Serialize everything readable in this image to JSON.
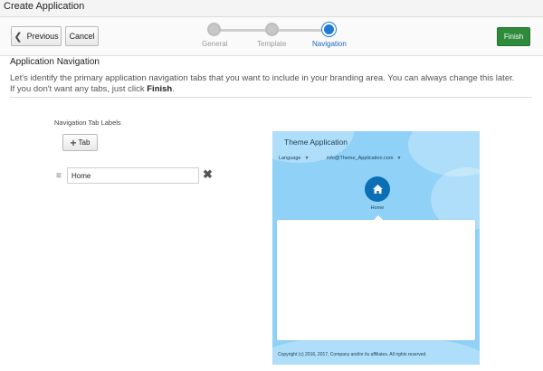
{
  "window": {
    "title": "Create Application"
  },
  "toolbar": {
    "previous_label": "Previous",
    "cancel_label": "Cancel",
    "finish_label": "Finish"
  },
  "train": {
    "steps": [
      {
        "label": "General",
        "state": "complete"
      },
      {
        "label": "Template",
        "state": "complete"
      },
      {
        "label": "Navigation",
        "state": "current"
      }
    ]
  },
  "section": {
    "title": "Application Navigation",
    "description_line1": "Let's identify the primary application navigation tabs that you want to include in your branding area. You can always change this later.",
    "description_line2_prefix": "If you don't want any tabs, just click ",
    "description_line2_bold": "Finish",
    "description_line2_suffix": "."
  },
  "tabs_editor": {
    "label": "Navigation Tab Labels",
    "add_button_label": "Tab",
    "items": [
      {
        "value": "Home"
      }
    ]
  },
  "preview": {
    "title": "Theme Application",
    "menu_language": "Language",
    "menu_user": "info@Theme_Application.com",
    "home_label": "Home",
    "footer": "Copyright (c) 2016, 2017, Company and/or its affiliates. All rights reserved.",
    "colors": {
      "sky": "#8fd1f7",
      "home_icon": "#0a6fb5"
    }
  },
  "colors": {
    "finish_button": "#2e8b3a",
    "train_active": "#1f7ad6"
  },
  "icons": {
    "previous": "chevron-left-icon",
    "add": "plus-icon",
    "drag": "drag-handle-icon",
    "remove": "close-icon",
    "home": "home-icon"
  }
}
